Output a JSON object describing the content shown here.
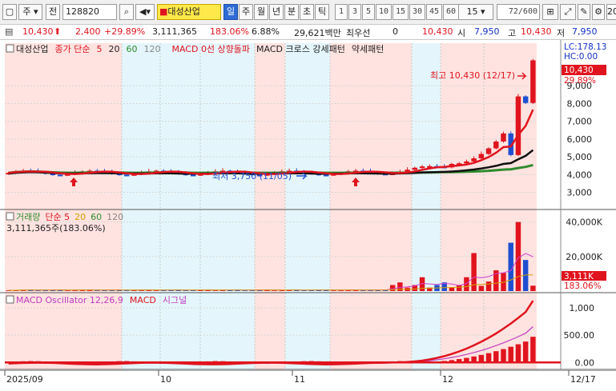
{
  "toolbar": {
    "market": "주",
    "prev_label": "전",
    "code": "128820",
    "stock_name": "대성산업",
    "periods": [
      "일",
      "주",
      "월",
      "년",
      "분",
      "초",
      "틱"
    ],
    "active_period": "일",
    "intervals": [
      "1",
      "3",
      "5",
      "10",
      "15",
      "30",
      "45",
      "60"
    ],
    "interval_value": "15",
    "count": "72",
    "count_total": "/600",
    "right_value": "20"
  },
  "quote": {
    "price": "10,430",
    "change": "2,400",
    "change_pct": "+29.89%",
    "volume": "3,111,365",
    "volume_ratio": "183.06%",
    "turnover": "6.88%",
    "amount": "29,621백만",
    "priority_label": "최우선",
    "priority_value": "0",
    "last": "10,430",
    "open_label": "시",
    "open": "7,950",
    "high_label": "고",
    "high": "10,430",
    "low_label": "저",
    "low": "7,950"
  },
  "price_panel": {
    "legend": [
      {
        "text": "대성산업",
        "color": "#222222"
      },
      {
        "text": "종가 단순",
        "color": "#e0141e"
      },
      {
        "text": "5",
        "color": "#e0141e"
      },
      {
        "text": "20",
        "color": "#222222"
      },
      {
        "text": "60",
        "color": "#2e8b2e"
      },
      {
        "text": "120",
        "color": "#888888"
      },
      {
        "text": "MACD 0선 상향돌파",
        "color": "#e0141e"
      },
      {
        "text": "MACD 크로스 강세패턴",
        "color": "#222222"
      },
      {
        "text": "약세패턴",
        "color": "#222222"
      }
    ],
    "lc_label": "LC:178.13",
    "hc_label": "HC:0.00",
    "high_annotation": "최고 10,430 (12/17)",
    "low_annotation": "최저 3,750 (11/05)",
    "last_tag": "10,430",
    "pct_tag": "29.89%",
    "y_ticks": [
      "9,000",
      "8,000",
      "7,000",
      "6,000",
      "5,000",
      "4,000",
      "3,000"
    ]
  },
  "volume_panel": {
    "legend": [
      {
        "text": "거래량",
        "color": "#2e8b2e"
      },
      {
        "text": "단순 5",
        "color": "#e0141e"
      },
      {
        "text": "20",
        "color": "#d4a000"
      },
      {
        "text": "60",
        "color": "#2e8b2e"
      },
      {
        "text": "120",
        "color": "#888888"
      }
    ],
    "info": "3,111,365주(183.06%)",
    "y_ticks": [
      "40,000K",
      "20,000K"
    ],
    "tag_value": "3,111K",
    "tag_pct": "183.06%"
  },
  "macd_panel": {
    "legend": [
      {
        "text": "MACD Oscillator 12,26,9",
        "color": "#c03cc0"
      },
      {
        "text": "MACD",
        "color": "#e0141e"
      },
      {
        "text": "시그널",
        "color": "#c03cc0"
      }
    ],
    "y_ticks": [
      "1,000",
      "500.00",
      "0.00"
    ]
  },
  "x_axis": {
    "labels": [
      "2025/09",
      "10",
      "11",
      "12",
      "12/17"
    ]
  },
  "colors": {
    "up": "#e0141e",
    "down": "#1f4fd1",
    "ma5": "#e0141e",
    "ma20": "#111111",
    "ma60": "#2e8b2e",
    "pink": "#ffe3e0",
    "cyan": "#e4f6fb"
  }
}
